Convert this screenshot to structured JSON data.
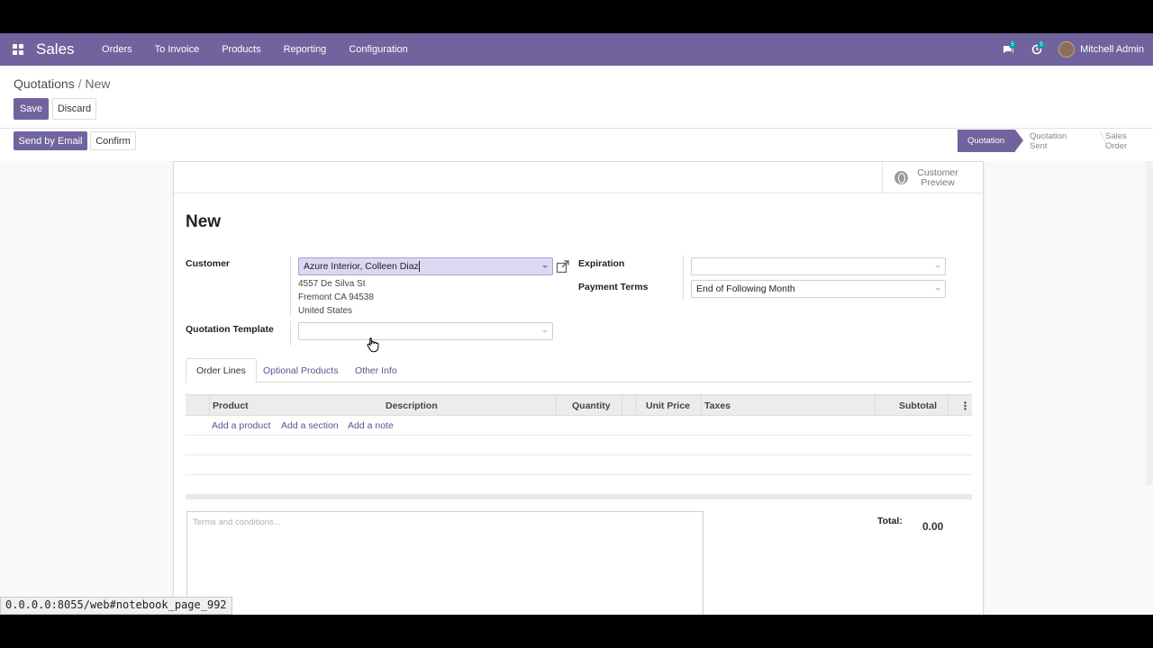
{
  "navbar": {
    "app_name": "Sales",
    "menu": [
      "Orders",
      "To Invoice",
      "Products",
      "Reporting",
      "Configuration"
    ],
    "messages_count": "5",
    "activities_count": "5",
    "user_name": "Mitchell Admin",
    "color": "#71639e"
  },
  "breadcrumb": {
    "parent": "Quotations",
    "separator": " / ",
    "current": "New"
  },
  "buttons": {
    "save": "Save",
    "discard": "Discard",
    "send_email": "Send by Email",
    "confirm": "Confirm"
  },
  "statusbar": {
    "stages": [
      "Quotation",
      "Quotation Sent",
      "Sales Order"
    ],
    "active": "Quotation"
  },
  "sheet": {
    "customer_preview": "Customer Preview",
    "title": "New",
    "customer_label": "Customer",
    "customer_value": "Azure Interior, Colleen Diaz",
    "address": [
      "4557 De Silva St",
      "Fremont CA 94538",
      "United States"
    ],
    "template_label": "Quotation Template",
    "template_value": "",
    "expiration_label": "Expiration",
    "expiration_value": "",
    "payment_terms_label": "Payment Terms",
    "payment_terms_value": "End of Following Month"
  },
  "tabs": [
    "Order Lines",
    "Optional Products",
    "Other Info"
  ],
  "order_lines": {
    "columns": [
      "Product",
      "Description",
      "Quantity",
      "Unit Price",
      "Taxes",
      "Subtotal"
    ],
    "add_product": "Add a product",
    "add_section": "Add a section",
    "add_note": "Add a note"
  },
  "terms_placeholder": "Terms and conditions...",
  "totals": {
    "label": "Total:",
    "value": "0.00"
  },
  "status_url": "0.0.0.0:8055/web#notebook_page_992"
}
